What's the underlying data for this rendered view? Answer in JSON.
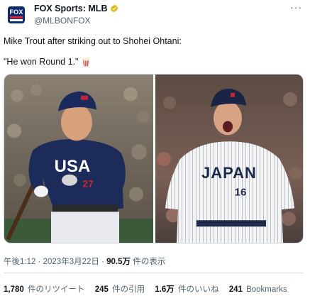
{
  "account": {
    "display_name": "FOX Sports: MLB",
    "handle": "@MLBONFOX",
    "avatar_text": "FOX",
    "more_label": "···"
  },
  "tweet": {
    "line1": "Mike Trout after striking out to Shohei Ohtani:",
    "line2": "\"He won Round 1.\""
  },
  "meta": {
    "time": "午後1:12",
    "sep1": " · ",
    "date": "2023年3月22日",
    "sep2": " · ",
    "views_num": "90.5万",
    "views_label": " 件の表示"
  },
  "stats": {
    "retweets_num": "1,780",
    "retweets_label": "件のリツイート",
    "quotes_num": "245",
    "quotes_label": "件の引用",
    "likes_num": "1.6万",
    "likes_label": "件のいいね",
    "bookmarks_num": "241",
    "bookmarks_label": "Bookmarks"
  },
  "media": {
    "left_jersey_text": "USA",
    "right_jersey_text": "JAPAN",
    "right_number": "16"
  },
  "colors": {
    "text": "#0f1419",
    "muted": "#536471",
    "verified_gold": "#e2b719",
    "fox_navy": "#0b2b6b",
    "usa_navy": "#1c2b59",
    "japan_navy": "#1d2a4a"
  },
  "icons": {
    "verified": "verified-badge-icon",
    "popcorn": "popcorn-icon",
    "more": "more-horizontal-icon"
  }
}
